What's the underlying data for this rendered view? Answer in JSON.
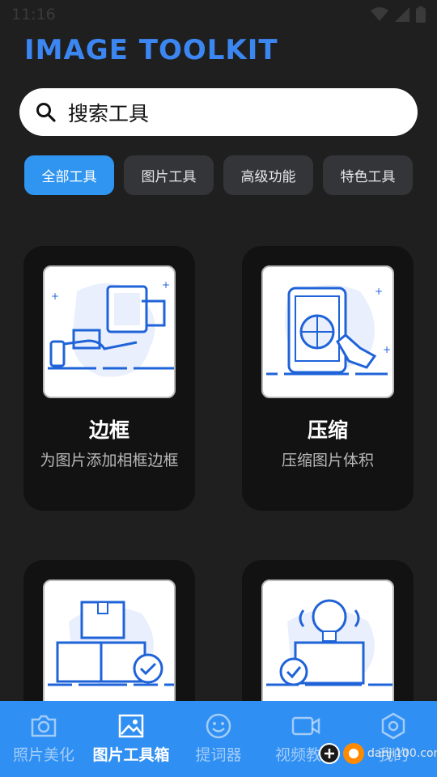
{
  "status": {
    "time": "11:16"
  },
  "app": {
    "logo": "IMAGE TOOLKIT"
  },
  "search": {
    "placeholder": "搜索工具"
  },
  "tabs": [
    {
      "label": "全部工具",
      "active": true
    },
    {
      "label": "图片工具",
      "active": false
    },
    {
      "label": "高级功能",
      "active": false
    },
    {
      "label": "特色工具",
      "active": false
    }
  ],
  "cards": [
    {
      "title": "边框",
      "desc": "为图片添加相框边框",
      "icon": "hand-frame-icon"
    },
    {
      "title": "压缩",
      "desc": "压缩图片体积",
      "icon": "tablet-compress-icon"
    },
    {
      "title": "",
      "desc": "",
      "icon": "boxes-check-icon"
    },
    {
      "title": "",
      "desc": "",
      "icon": "lightbulb-check-icon"
    }
  ],
  "nav": [
    {
      "label": "照片美化",
      "icon": "camera-icon",
      "active": false
    },
    {
      "label": "图片工具箱",
      "icon": "image-icon",
      "active": true
    },
    {
      "label": "提词器",
      "icon": "smile-icon",
      "active": false
    },
    {
      "label": "视频教学",
      "icon": "video-icon",
      "active": false
    },
    {
      "label": "我的",
      "icon": "hexagon-settings-icon",
      "active": false
    }
  ],
  "watermark": {
    "text": "danji100.com"
  },
  "colors": {
    "accent": "#2f95f0",
    "nav": "#2f8ff2",
    "icon": "#1f63d8",
    "background": "#1f1f1f"
  }
}
